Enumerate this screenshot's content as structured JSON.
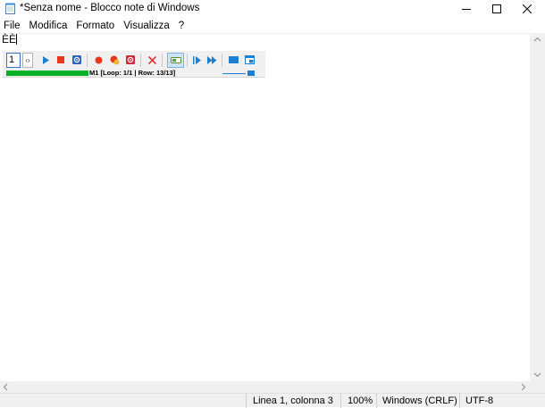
{
  "window": {
    "title": "*Senza nome - Blocco note di Windows",
    "icons": [
      "notepad-app-icon",
      "minimize-icon",
      "maximize-icon",
      "close-icon"
    ]
  },
  "menu": {
    "items": [
      {
        "label": "File"
      },
      {
        "label": "Modifica"
      },
      {
        "label": "Formato"
      },
      {
        "label": "Visualizza"
      },
      {
        "label": "?"
      }
    ]
  },
  "editor": {
    "content": "ÈÈ"
  },
  "macro_toolbar": {
    "macro_number": "1",
    "progress_fraction": 1.0,
    "status_text": "M1 [Loop: 1/1 | Row: 13/13]",
    "colors": {
      "play": "#1e7fd0",
      "stop": "#e8381a",
      "record": "#e8381a",
      "delete": "#e02020",
      "progress": "#06b025"
    },
    "icons": [
      "play-icon",
      "stop-icon",
      "settings-gear-icon",
      "record-icon",
      "record-mouse-icon",
      "record-settings-icon",
      "delete-icon",
      "toggle-mode-icon",
      "step-icon",
      "fast-play-icon",
      "compact-view-icon",
      "window-icon"
    ]
  },
  "status_bar": {
    "position": "Linea 1, colonna 3",
    "zoom": "100%",
    "line_endings": "Windows (CRLF)",
    "encoding": "UTF-8"
  }
}
